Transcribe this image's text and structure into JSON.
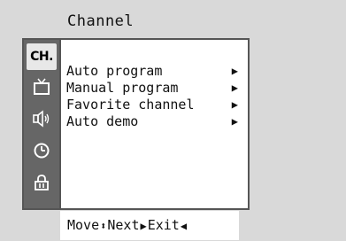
{
  "title": "Channel",
  "sidebar": {
    "items": [
      {
        "label": "CH.",
        "icon": "channel-label",
        "active": true
      },
      {
        "icon": "tv-icon"
      },
      {
        "icon": "speaker-icon"
      },
      {
        "icon": "clock-icon"
      },
      {
        "icon": "lock-icon"
      }
    ]
  },
  "menu": {
    "items": [
      {
        "label": "Auto program",
        "arrow": "▶"
      },
      {
        "label": "Manual program",
        "arrow": "▶"
      },
      {
        "label": "Favorite channel",
        "arrow": "▶"
      },
      {
        "label": "Auto demo",
        "arrow": "▶"
      }
    ]
  },
  "footer": {
    "move_label": "Move",
    "move_symbol": "⬍",
    "next_label": "Next",
    "next_symbol": "▶",
    "exit_label": "Exit",
    "exit_symbol": "◀"
  }
}
